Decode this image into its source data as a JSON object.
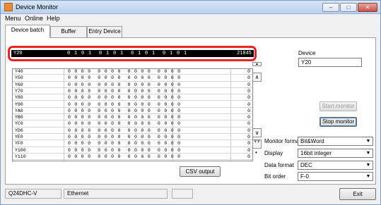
{
  "window": {
    "title": "Device Monitor",
    "controls": [
      "–",
      "□",
      "✕"
    ]
  },
  "menu": [
    "Menu",
    "Online",
    "Help"
  ],
  "tabs": [
    "Device batch",
    "Buffer Memory",
    "Entry Device"
  ],
  "top_row": {
    "device": "Y20",
    "bits": "0 1 0 1  0 1 0 1  0 1 0 1  0 1 0 1",
    "value": "21845"
  },
  "rows": [
    {
      "device": "Y40",
      "bits": "0 0 0 0  0 0 0 0  0 0 0 0  0 0 0 0",
      "value": "0"
    },
    {
      "device": "Y50",
      "bits": "0 0 0 0  0 0 0 0  0 0 0 0  0 0 0 0",
      "value": "0"
    },
    {
      "device": "Y60",
      "bits": "0 0 0 0  0 0 0 0  0 0 0 0  0 0 0 0",
      "value": "0"
    },
    {
      "device": "Y70",
      "bits": "0 0 0 0  0 0 0 0  0 0 0 0  0 0 0 0",
      "value": "0"
    },
    {
      "device": "Y80",
      "bits": "0 0 0 0  0 0 0 0  0 0 0 0  0 0 0 0",
      "value": "0"
    },
    {
      "device": "Y90",
      "bits": "0 0 0 0  0 0 0 0  0 0 0 0  0 0 0 0",
      "value": "0"
    },
    {
      "device": "YA0",
      "bits": "0 0 0 0  0 0 0 0  0 0 0 0  0 0 0 0",
      "value": "0"
    },
    {
      "device": "YB0",
      "bits": "0 0 0 0  0 0 0 0  0 0 0 0  0 0 0 0",
      "value": "0"
    },
    {
      "device": "YC0",
      "bits": "0 0 0 0  0 0 0 0  0 0 0 0  0 0 0 0",
      "value": "0"
    },
    {
      "device": "YD0",
      "bits": "0 0 0 0  0 0 0 0  0 0 0 0  0 0 0 0",
      "value": "0"
    },
    {
      "device": "YE0",
      "bits": "0 0 0 0  0 0 0 0  0 0 0 0  0 0 0 0",
      "value": "0"
    },
    {
      "device": "YF0",
      "bits": "0 0 0 0  0 0 0 0  0 0 0 0  0 0 0 0",
      "value": "0"
    },
    {
      "device": "Y100",
      "bits": "0 0 0 0  0 0 0 0  0 0 0 0  0 0 0 0",
      "value": "0"
    },
    {
      "device": "Y110",
      "bits": "0 0 0 0  0 0 0 0  0 0 0 0  0 0 0 0",
      "value": "0"
    }
  ],
  "scroll_icons": {
    "up": "▲",
    "top": "∧",
    "bottom": "∨",
    "double_down": "∨∨",
    "dot": "•"
  },
  "device_label": "Device",
  "device_value": "Y20",
  "buttons": {
    "start_monitor": "Start monitor",
    "stop_monitor": "Stop monitor",
    "csv_output": "CSV output",
    "exit": "Exit"
  },
  "monitor_format": {
    "label": "Monitor format",
    "value": "Bit&Word"
  },
  "display": {
    "label": "Display",
    "value": "16bit integer"
  },
  "data_format": {
    "label": "Data format",
    "value": "DEC"
  },
  "bit_order": {
    "label": "Bit order",
    "value": "F-0"
  },
  "status_bar": {
    "cpu": "Q24DHC-V",
    "connection": "Ethernet",
    "extra": ""
  },
  "colors": {
    "highlight": "#e22222",
    "titlebar": "#c5daf3"
  }
}
